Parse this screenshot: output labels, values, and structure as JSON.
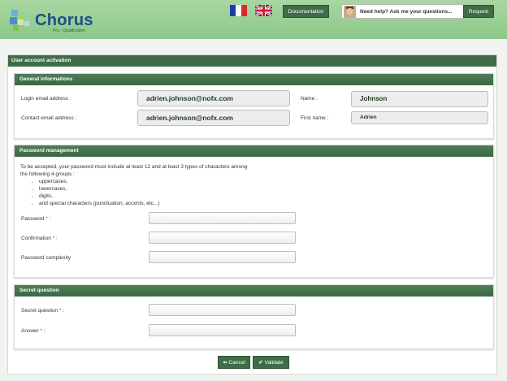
{
  "header": {
    "logo_text": "Chorus",
    "logo_subtitle": "Pro · Qualification",
    "documentation_label": "Documentation",
    "help_text": "Need help? Ask me your questions...",
    "request_label": "Request"
  },
  "page": {
    "title": "User account activation"
  },
  "general": {
    "title": "General informations",
    "login_email_label": "Login email address :",
    "login_email_value": "adrien.johnson@nofx.com",
    "contact_email_label": "Contact email address :",
    "contact_email_value": "adrien.johnson@nofx.com",
    "name_label": "Name :",
    "name_value": "Johnson",
    "first_name_label": "First name :",
    "first_name_value": "Adrien"
  },
  "password": {
    "title": "Password management",
    "intro_line1": "To be accepted, your password must include at least 12 and at least 3 types of characters among",
    "intro_line2": "the following 4 groups :",
    "groups": [
      "uppercases,",
      "lowercases,",
      "digits,",
      "and special characters (punctuation, accents, etc...)"
    ],
    "password_label": "Password",
    "confirmation_label": "Confirmation",
    "complexity_label": "Password complexity",
    "required_mark": "*",
    "colon": ":"
  },
  "secret": {
    "title": "Secret question",
    "question_label": "Secret question",
    "answer_label": "Answer"
  },
  "footer": {
    "cancel_label": "Cancel",
    "validate_label": "Validate"
  },
  "colors": {
    "header_green": "#a9d7a3",
    "panel_green": "#3f6d47",
    "required_green": "#2f8a3a"
  }
}
